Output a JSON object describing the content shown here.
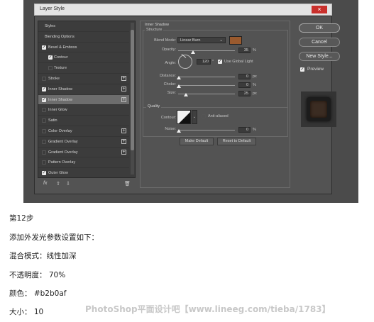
{
  "window": {
    "title": "Layer Style",
    "close_glyph": "×"
  },
  "styles_list": {
    "items": [
      {
        "label": "Styles"
      },
      {
        "label": "Blending Options"
      },
      {
        "label": "Bevel & Emboss",
        "checked": true
      },
      {
        "label": "Contour",
        "checked": true
      },
      {
        "label": "Texture",
        "checked": false
      },
      {
        "label": "Stroke",
        "checked": false
      },
      {
        "label": "Inner Shadow",
        "checked": true
      },
      {
        "label": "Inner Shadow",
        "checked": true,
        "selected": true
      },
      {
        "label": "Inner Glow",
        "checked": false
      },
      {
        "label": "Satin",
        "checked": false
      },
      {
        "label": "Color Overlay",
        "checked": false
      },
      {
        "label": "Gradient Overlay",
        "checked": false
      },
      {
        "label": "Gradient Overlay",
        "checked": false
      },
      {
        "label": "Pattern Overlay",
        "checked": false
      },
      {
        "label": "Outer Glow",
        "checked": true
      }
    ],
    "plus_glyph": "+",
    "check_glyph": "✓",
    "bottom": {
      "fx": "fx",
      "up": "⇧",
      "down": "⇩",
      "trash": "🗑"
    }
  },
  "inner_shadow": {
    "section_title": "Inner Shadow",
    "structure_title": "Structure",
    "blend_mode_label": "Blend Mode:",
    "blend_mode_value": "Linear Burn",
    "color_swatch": "#9a5a2e",
    "opacity_label": "Opacity:",
    "opacity_value": "35",
    "opacity_unit": "%",
    "angle_label": "Angle:",
    "angle_value": "120",
    "angle_unit": "°",
    "global_light_label": "Use Global Light",
    "global_light_checked": true,
    "distance_label": "Distance:",
    "distance_value": "0",
    "distance_unit": "px",
    "choke_label": "Choke:",
    "choke_value": "0",
    "choke_unit": "%",
    "size_label": "Size:",
    "size_value": "25",
    "size_unit": "px",
    "quality_title": "Quality",
    "contour_label": "Contour:",
    "anti_aliased_label": "Anti-aliased",
    "noise_label": "Noise:",
    "noise_value": "0",
    "noise_unit": "%",
    "make_default": "Make Default",
    "reset_default": "Reset to Default"
  },
  "right_buttons": {
    "ok": "OK",
    "cancel": "Cancel",
    "new_style": "New Style...",
    "preview_label": "Preview",
    "preview_checked": true
  },
  "caption": {
    "step": "第12步",
    "line1": "添加外发光参数设置如下：",
    "line2": "混合模式：线性加深",
    "line3": "不透明度： 70%",
    "line4": "颜色： #b2b0af",
    "line5": "大小： 10"
  },
  "watermark": "PhotoShop平面设计吧【www.lineeg.com/tieba/1783】"
}
